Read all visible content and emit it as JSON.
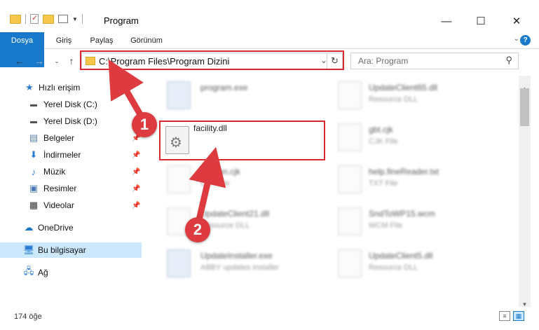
{
  "window": {
    "title": "Program",
    "controls": {
      "minimize": "—",
      "maximize": "☐",
      "close": "✕"
    }
  },
  "ribbon": {
    "tabs": [
      "Dosya",
      "Giriş",
      "Paylaş",
      "Görünüm"
    ],
    "accent": "#1979ca"
  },
  "navigation": {
    "address": "C:\\Program Files\\Program Dizini",
    "search_placeholder": "Ara: Program"
  },
  "sidebar": {
    "items": [
      {
        "label": "Hızlı erişim",
        "icon": "star-icon",
        "pinned": false
      },
      {
        "label": "Yerel Disk (C:)",
        "icon": "drive-icon",
        "pinned": false
      },
      {
        "label": "Yerel Disk (D:)",
        "icon": "drive-icon",
        "pinned": false
      },
      {
        "label": "Belgeler",
        "icon": "documents-icon",
        "pinned": true
      },
      {
        "label": "İndirmeler",
        "icon": "download-icon",
        "pinned": true
      },
      {
        "label": "Müzik",
        "icon": "music-icon",
        "pinned": true
      },
      {
        "label": "Resimler",
        "icon": "pictures-icon",
        "pinned": true
      },
      {
        "label": "Videolar",
        "icon": "video-icon",
        "pinned": true
      },
      {
        "label": "OneDrive",
        "icon": "cloud-icon",
        "pinned": false
      },
      {
        "label": "Bu bilgisayar",
        "icon": "computer-icon",
        "pinned": false,
        "selected": true
      },
      {
        "label": "Ağ",
        "icon": "network-icon",
        "pinned": false
      }
    ]
  },
  "files": {
    "left_column": [
      {
        "name": "program.exe",
        "type": ""
      },
      {
        "name": "facility.dll",
        "type": ""
      },
      {
        "name": "Korean.cjk",
        "type": "CJK File"
      },
      {
        "name": "UpdateClient21.dll",
        "type": "Resource DLL"
      },
      {
        "name": "UpdateInstaller.exe",
        "type": "ABBY updates installer"
      }
    ],
    "right_column": [
      {
        "name": "UpdateClient65.dll",
        "type": "Resource DLL"
      },
      {
        "name": "gbt.cjk",
        "type": "CJK File"
      },
      {
        "name": "help.fineReader.txt",
        "type": "TXT File"
      },
      {
        "name": "SndToWP15.wcm",
        "type": "WCM File"
      },
      {
        "name": "UpdateClient5.dll",
        "type": "Resource DLL"
      }
    ]
  },
  "annotations": {
    "step1": "1",
    "step2": "2",
    "highlight_color": "#d9282f",
    "badge_color": "#dd3b3f"
  },
  "status": {
    "item_count": "174 öğe"
  }
}
